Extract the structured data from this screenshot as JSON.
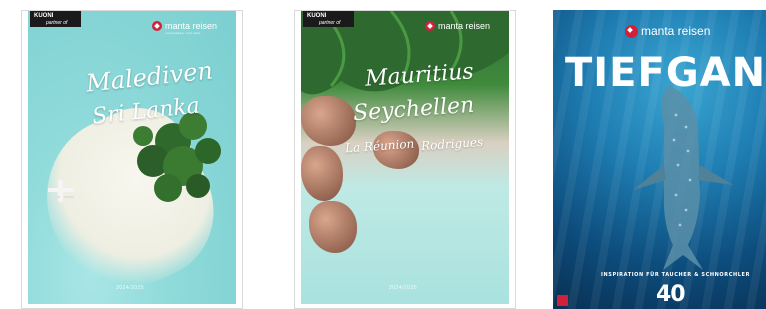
{
  "covers": [
    {
      "id": "maldives",
      "title_lines": [
        "Malediven",
        "Sri Lanka"
      ],
      "brand": "manta reisen",
      "brand_tagline": "unterwasser und mehr",
      "partner_logo": [
        "KUONI",
        "partner of"
      ],
      "year": "2024/2025"
    },
    {
      "id": "mauritius",
      "title_lines": [
        "Mauritius",
        "Seychellen"
      ],
      "subtitle_left": "La Réunion",
      "subtitle_right": "Rodrigues",
      "brand": "manta reisen",
      "partner_logo": [
        "KUONI",
        "partner of"
      ],
      "year": "2024/2025"
    },
    {
      "id": "tiefgang",
      "brand": "manta reisen",
      "title": "TIEFGANG",
      "tagline": "INSPIRATION FÜR TAUCHER & SCHNORCHLER",
      "anniversary": "40"
    }
  ]
}
